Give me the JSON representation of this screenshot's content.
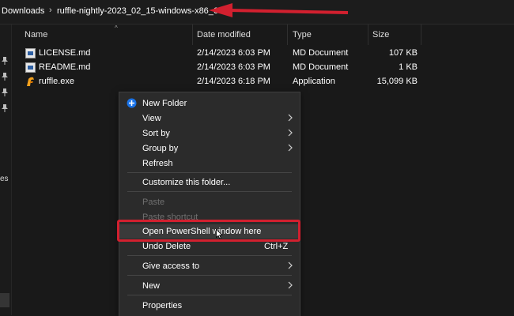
{
  "breadcrumb": {
    "parent": "Downloads",
    "current": "ruffle-nightly-2023_02_15-windows-x86_64"
  },
  "nav": {
    "fragment": "es"
  },
  "columns": {
    "name": "Name",
    "date": "Date modified",
    "type": "Type",
    "size": "Size"
  },
  "files": [
    {
      "name": "LICENSE.md",
      "date": "2/14/2023 6:03 PM",
      "type": "MD Document",
      "size": "107 KB",
      "icon": "md-document-icon"
    },
    {
      "name": "README.md",
      "date": "2/14/2023 6:03 PM",
      "type": "MD Document",
      "size": "1 KB",
      "icon": "md-document-icon"
    },
    {
      "name": "ruffle.exe",
      "date": "2/14/2023 6:18 PM",
      "type": "Application",
      "size": "15,099 KB",
      "icon": "ruffle-app-icon"
    }
  ],
  "menu": {
    "new_folder": "New Folder",
    "view": "View",
    "sort_by": "Sort by",
    "group_by": "Group by",
    "refresh": "Refresh",
    "customize": "Customize this folder...",
    "paste": "Paste",
    "paste_shortcut": "Paste shortcut",
    "open_powershell": "Open PowerShell window here",
    "undo_delete": "Undo Delete",
    "undo_shortcut": "Ctrl+Z",
    "give_access": "Give access to",
    "new": "New",
    "properties": "Properties"
  },
  "colors": {
    "background": "#191919",
    "menu_bg": "#2b2b2b",
    "highlight_red": "#d2202f",
    "new_folder_blue": "#1a73e8"
  }
}
